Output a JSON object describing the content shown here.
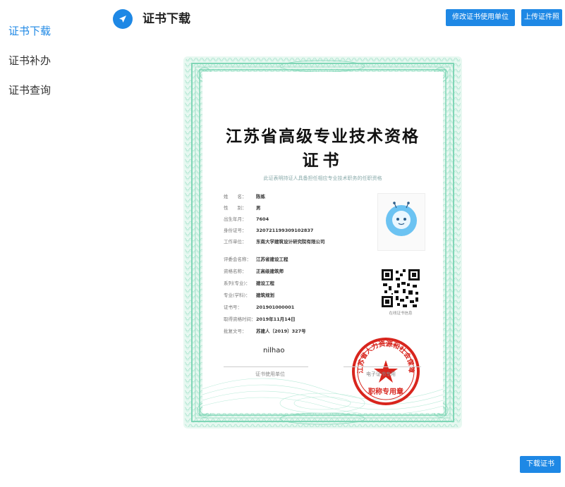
{
  "sidebar": {
    "items": [
      {
        "label": "证书下载",
        "active": true
      },
      {
        "label": "证书补办",
        "active": false
      },
      {
        "label": "证书查询",
        "active": false
      }
    ]
  },
  "header": {
    "title": "证书下载",
    "modify_button": "修改证书使用单位",
    "upload_button": "上传证件照"
  },
  "certificate": {
    "title_line1": "江苏省高级专业技术资格",
    "title_line2": "证书",
    "subtitle": "此证表明持证人具备担任相应专业技术职务的任职资格",
    "fields": [
      {
        "label": "姓　　名：",
        "value": "陈练"
      },
      {
        "label": "性　　别：",
        "value": "男"
      },
      {
        "label": "出生年月：",
        "value": "7604"
      },
      {
        "label": "身份证号：",
        "value": "320721199309102837"
      },
      {
        "label": "工作单位：",
        "value": "东南大学建筑设计研究院有限公司"
      },
      {
        "label": "评委会名称：",
        "value": "江苏省建设工程"
      },
      {
        "label": "资格名称：",
        "value": "正高级建筑师"
      },
      {
        "label": "系列(专业)：",
        "value": "建设工程"
      },
      {
        "label": "专业(学科)：",
        "value": "建筑规划"
      },
      {
        "label": "证书号：",
        "value": "201901000001"
      },
      {
        "label": "取得资格时间：",
        "value": "2019年11月14日"
      },
      {
        "label": "批复文号：",
        "value": "苏建人〔2019〕327号"
      }
    ],
    "qr_caption": "在线证书信息",
    "handwritten_value": "nilhao",
    "footer_left": "证书使用单位",
    "footer_right": "电子证书专用",
    "seal_text": "江苏省人力资源和社会保障厅",
    "seal_bottom": "职称专用章"
  },
  "footer": {
    "download_button": "下载证书"
  },
  "colors": {
    "accent": "#1e88e5",
    "guilloche": "#7fd6b6",
    "seal_red": "#d8251d"
  }
}
